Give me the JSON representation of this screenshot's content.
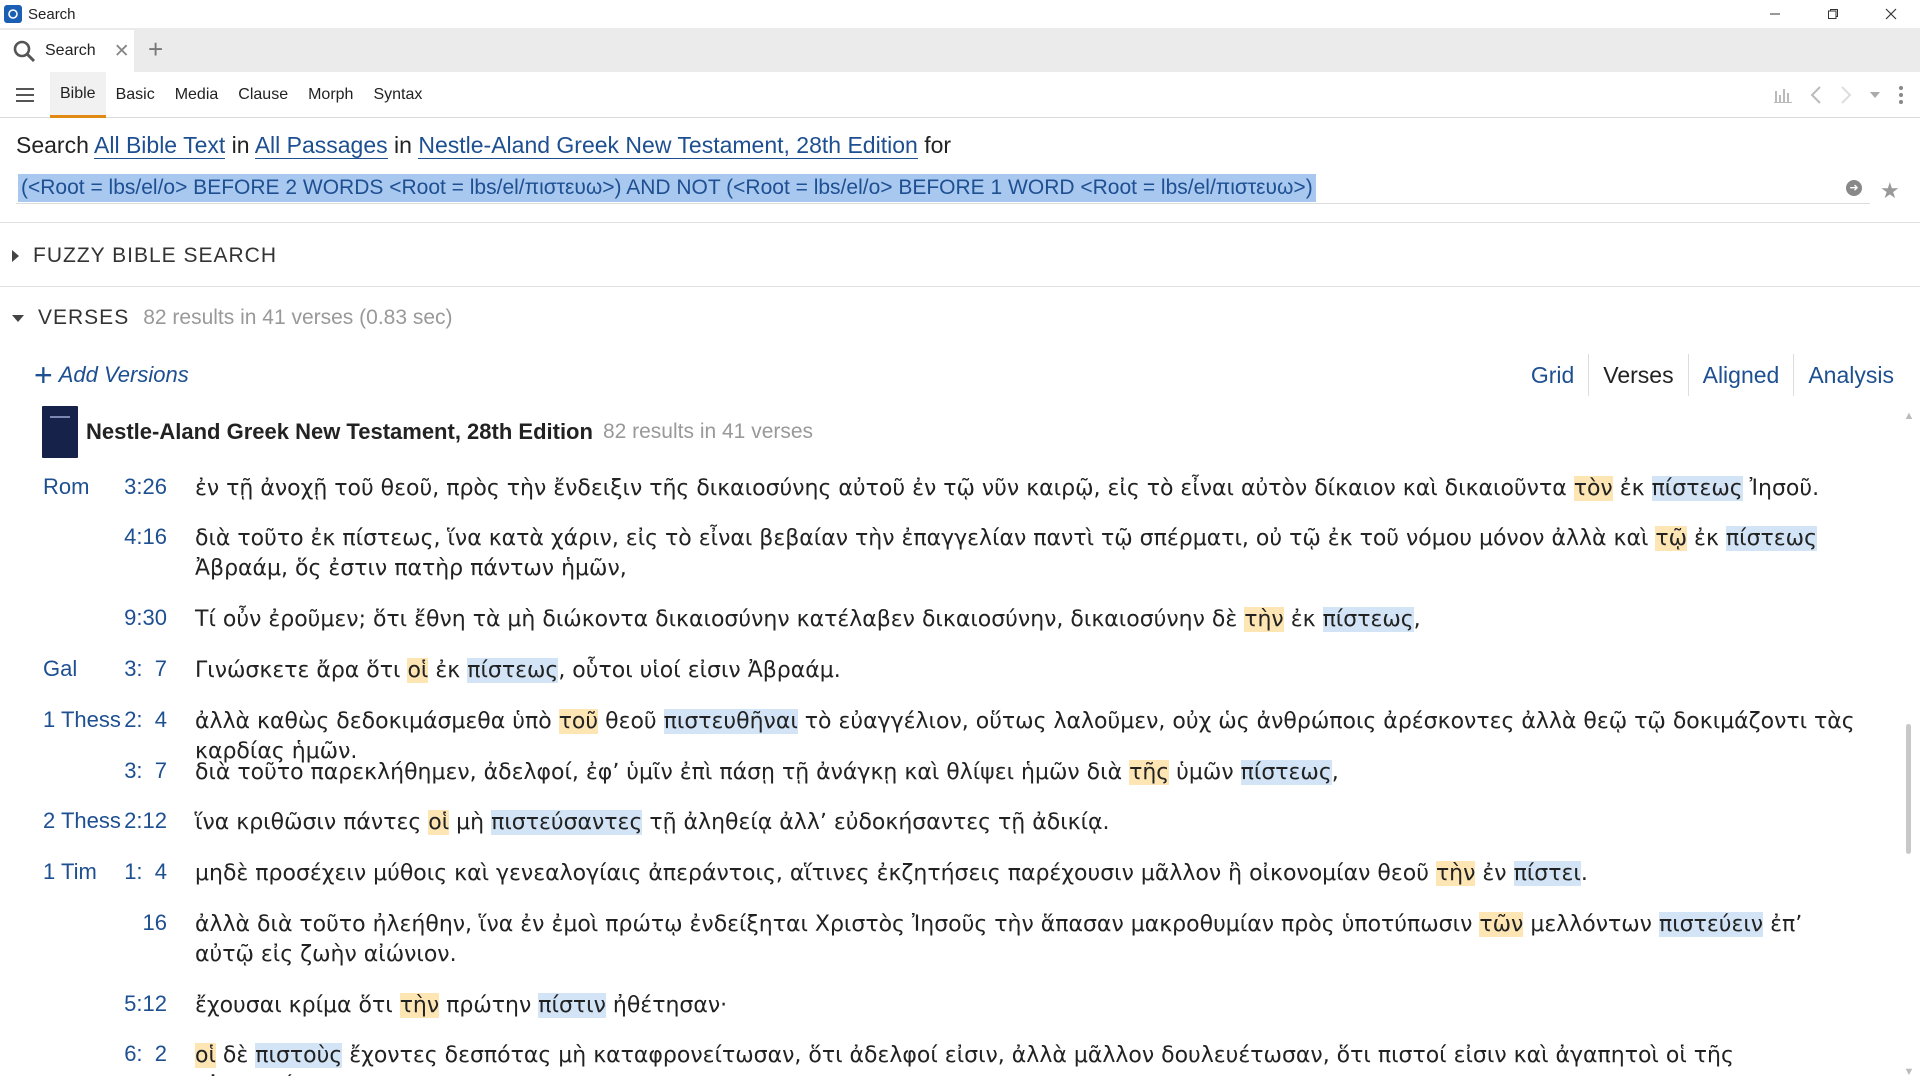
{
  "window": {
    "title": "Search"
  },
  "tabs": {
    "active_label": "Search"
  },
  "toolbar": {
    "tabs": [
      "Bible",
      "Basic",
      "Media",
      "Clause",
      "Morph",
      "Syntax"
    ]
  },
  "search": {
    "prefix": "Search",
    "scope": "All Bible Text",
    "in1": "in",
    "range": "All Passages",
    "in2": "in",
    "resource": "Nestle-Aland Greek New Testament, 28th Edition",
    "for": "for",
    "query": "(<Root = lbs/el/o> BEFORE 2 WORDS <Root = lbs/el/πιστευω>) AND NOT (<Root = lbs/el/o> BEFORE 1 WORD <Root = lbs/el/πιστευω>)"
  },
  "fuzzy": {
    "title": "FUZZY BIBLE SEARCH"
  },
  "verses": {
    "title": "VERSES",
    "meta": "82 results in 41 verses (0.83 sec)",
    "add_versions": "Add Versions",
    "views": [
      "Grid",
      "Verses",
      "Aligned",
      "Analysis"
    ],
    "active_view": "Verses"
  },
  "resource": {
    "title": "Nestle-Aland Greek New Testament, 28th Edition",
    "meta": "82 results in 41 verses"
  },
  "colors": {
    "link": "#1d4f91",
    "article_highlight": "#fde6b4",
    "verb_highlight": "#d2e4f6",
    "accent": "#e08a14"
  },
  "results": [
    {
      "book": "Rom",
      "ref": "3:26",
      "segments": [
        {
          "t": "ἐν τῇ ἀνοχῇ τοῦ θεοῦ, πρὸς τὴν ἔνδειξιν τῆς δικαιοσύνης αὐτοῦ ἐν τῷ νῦν καιρῷ, εἰς τὸ εἶναι αὐτὸν δίκαιον καὶ δικαιοῦντα "
        },
        {
          "t": "τὸν",
          "h": 1
        },
        {
          "t": " ἐκ "
        },
        {
          "t": "πίστεως",
          "h": 2
        },
        {
          "t": " Ἰησοῦ."
        }
      ]
    },
    {
      "book": "",
      "ref": "4:16",
      "segments": [
        {
          "t": "διὰ τοῦτο ἐκ πίστεως, ἵνα κατὰ χάριν, εἰς τὸ εἶναι βεβαίαν τὴν ἐπαγγελίαν παντὶ τῷ σπέρματι, οὐ τῷ ἐκ τοῦ νόμου μόνον ἀλλὰ καὶ "
        },
        {
          "t": "τῷ",
          "h": 1
        },
        {
          "t": " ἐκ "
        },
        {
          "t": "πίστεως",
          "h": 2
        },
        {
          "t": " Ἀβραάμ, ὅς ἐστιν πατὴρ πάντων ἡμῶν,"
        }
      ]
    },
    {
      "book": "",
      "ref": "9:30",
      "segments": [
        {
          "t": "Τί οὖν ἐροῦμεν; ὅτι ἔθνη τὰ μὴ διώκοντα δικαιοσύνην κατέλαβεν δικαιοσύνην, δικαιοσύνην δὲ "
        },
        {
          "t": "τὴν",
          "h": 1
        },
        {
          "t": " ἐκ "
        },
        {
          "t": "πίστεως",
          "h": 2
        },
        {
          "t": ","
        }
      ]
    },
    {
      "book": "Gal",
      "ref": "3:  7",
      "segments": [
        {
          "t": "Γινώσκετε ἄρα ὅτι "
        },
        {
          "t": "οἱ",
          "h": 1
        },
        {
          "t": " ἐκ "
        },
        {
          "t": "πίστεως",
          "h": 2
        },
        {
          "t": ", οὗτοι υἱοί εἰσιν Ἀβραάμ."
        }
      ]
    },
    {
      "book": "1 Thess",
      "ref": "2:  4",
      "segments": [
        {
          "t": "ἀλλὰ καθὼς δεδοκιμάσμεθα ὑπὸ "
        },
        {
          "t": "τοῦ",
          "h": 1
        },
        {
          "t": " θεοῦ "
        },
        {
          "t": "πιστευθῆναι",
          "h": 2
        },
        {
          "t": " τὸ εὐαγγέλιον, οὕτως λαλοῦμεν, οὐχ ὡς ἀνθρώποις ἀρέσκοντες ἀλλὰ θεῷ τῷ δοκιμάζοντι τὰς καρδίας ἡμῶν."
        }
      ]
    },
    {
      "book": "",
      "ref": "3:  7",
      "segments": [
        {
          "t": "διὰ τοῦτο παρεκλήθημεν, ἀδελφοί, ἐφʼ ὑμῖν ἐπὶ πάσῃ τῇ ἀνάγκῃ καὶ θλίψει ἡμῶν διὰ "
        },
        {
          "t": "τῆς",
          "h": 1
        },
        {
          "t": " ὑμῶν "
        },
        {
          "t": "πίστεως",
          "h": 2
        },
        {
          "t": ","
        }
      ]
    },
    {
      "book": "2 Thess",
      "ref": "2:12",
      "segments": [
        {
          "t": "ἵνα κριθῶσιν πάντες "
        },
        {
          "t": "οἱ",
          "h": 1
        },
        {
          "t": " μὴ "
        },
        {
          "t": "πιστεύσαντες",
          "h": 2
        },
        {
          "t": " τῇ ἀληθείᾳ ἀλλʼ εὐδοκήσαντες τῇ ἀδικίᾳ."
        }
      ]
    },
    {
      "book": "1 Tim",
      "ref": "1:  4",
      "segments": [
        {
          "t": "μηδὲ προσέχειν μύθοις καὶ γενεαλογίαις ἀπεράντοις, αἵτινες ἐκζητήσεις παρέχουσιν μᾶλλον ἢ οἰκονομίαν θεοῦ "
        },
        {
          "t": "τὴν",
          "h": 1
        },
        {
          "t": " ἐν "
        },
        {
          "t": "πίστει",
          "h": 2
        },
        {
          "t": "."
        }
      ]
    },
    {
      "book": "",
      "ref": "16",
      "segments": [
        {
          "t": "ἀλλὰ διὰ τοῦτο ἠλεήθην, ἵνα ἐν ἐμοὶ πρώτῳ ἐνδείξηται Χριστὸς Ἰησοῦς τὴν ἅπασαν μακροθυμίαν πρὸς ὑποτύπωσιν "
        },
        {
          "t": "τῶν",
          "h": 1
        },
        {
          "t": " μελλόντων "
        },
        {
          "t": "πιστεύειν",
          "h": 2
        },
        {
          "t": " ἐπʼ αὐτῷ εἰς ζωὴν αἰώνιον."
        }
      ]
    },
    {
      "book": "",
      "ref": "5:12",
      "segments": [
        {
          "t": "ἔχουσαι κρίμα ὅτι "
        },
        {
          "t": "τὴν",
          "h": 1
        },
        {
          "t": " πρώτην "
        },
        {
          "t": "πίστιν",
          "h": 2
        },
        {
          "t": " ἠθέτησαν·"
        }
      ]
    },
    {
      "book": "",
      "ref": "6:  2",
      "segments": [
        {
          "t": "οἱ",
          "h": 1
        },
        {
          "t": " δὲ "
        },
        {
          "t": "πιστοὺς",
          "h": 2
        },
        {
          "t": " ἔχοντες δεσπότας μὴ καταφρονείτωσαν, ὅτι ἀδελφοί εἰσιν, ἀλλὰ μᾶλλον δουλευέτωσαν, ὅτι πιστοί εἰσιν καὶ ἀγαπητοὶ οἱ τῆς εὐεργεσίας"
        }
      ]
    }
  ]
}
